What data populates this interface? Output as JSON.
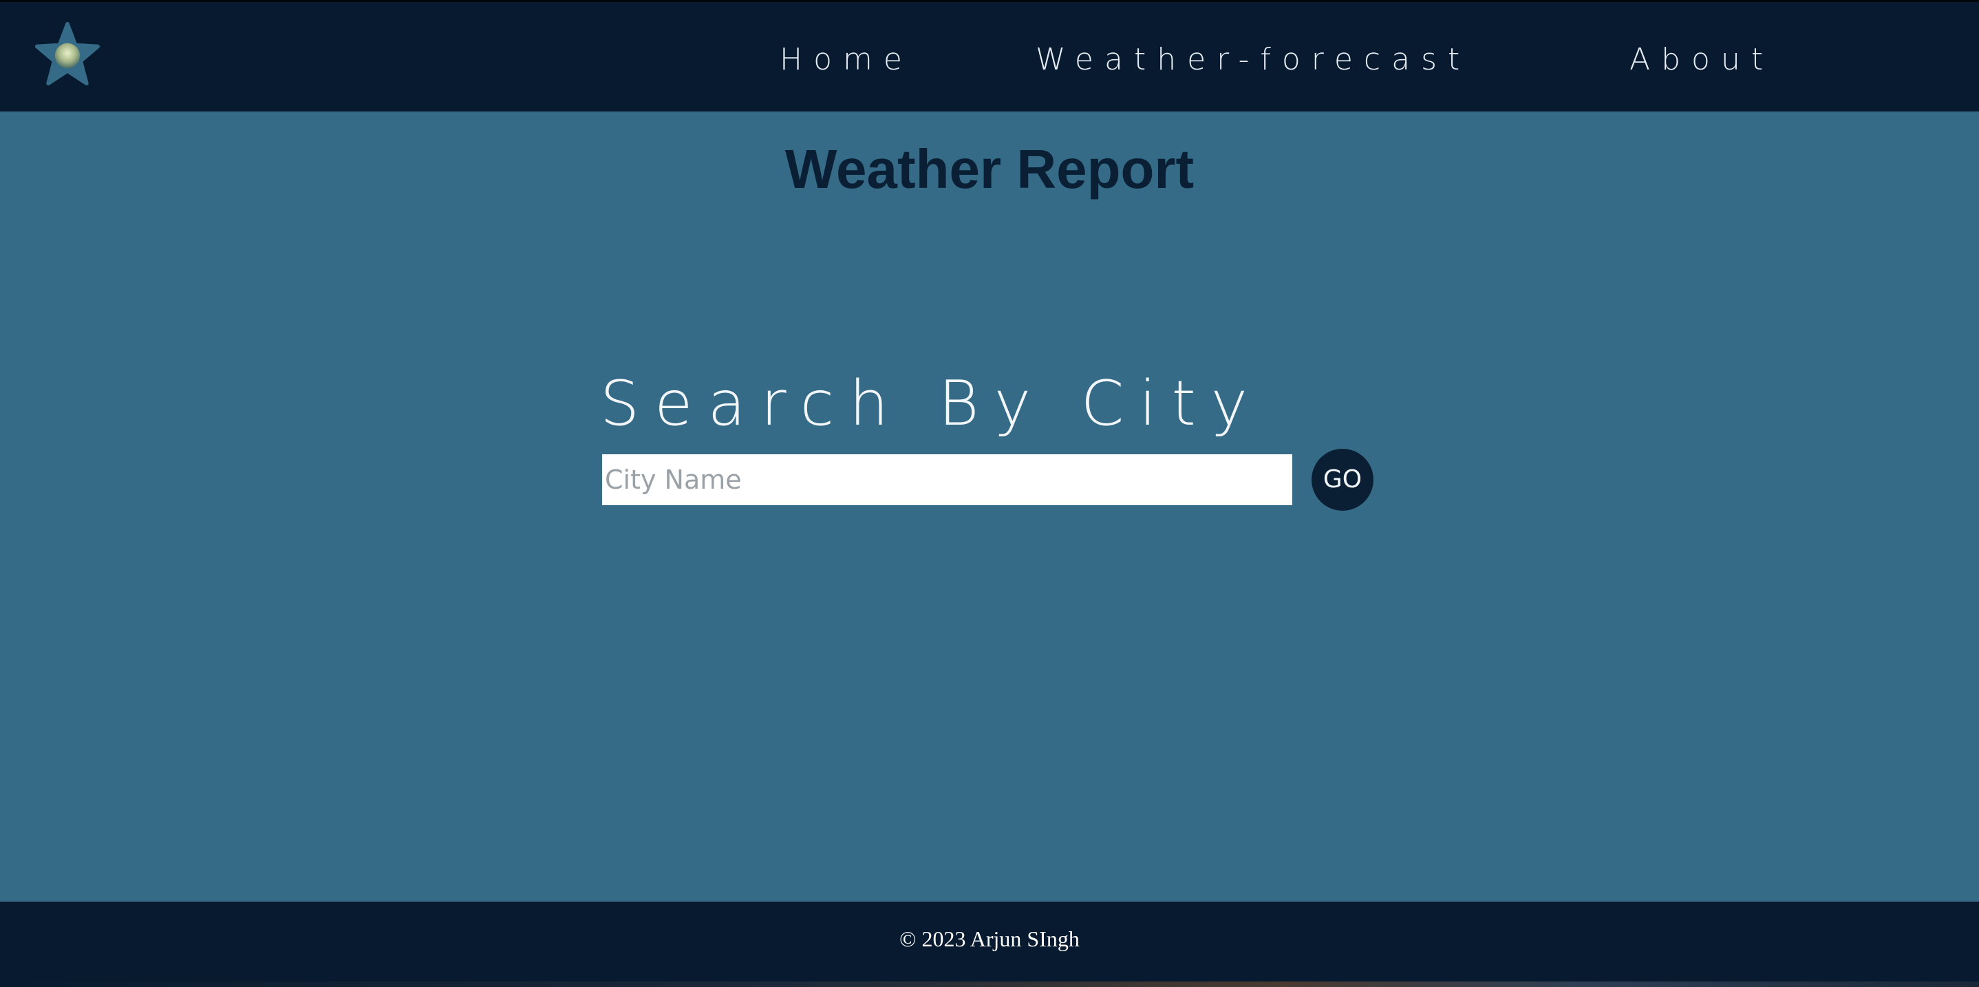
{
  "navbar": {
    "logo_icon": "star-logo-icon",
    "links": [
      {
        "label": "Home"
      },
      {
        "label": "Weather-forecast"
      },
      {
        "label": "About"
      }
    ]
  },
  "main": {
    "title": "Weather Report",
    "search": {
      "heading": "Search By City",
      "placeholder": "City Name",
      "value": "",
      "button_label": "GO"
    }
  },
  "footer": {
    "copyright": "© 2023 Arjun SIngh"
  },
  "colors": {
    "navbar_bg": "#081a2f",
    "main_bg": "#356b87",
    "title_text": "#0a1f33",
    "button_bg": "#0a1f33",
    "footer_bg": "#081a2f"
  }
}
